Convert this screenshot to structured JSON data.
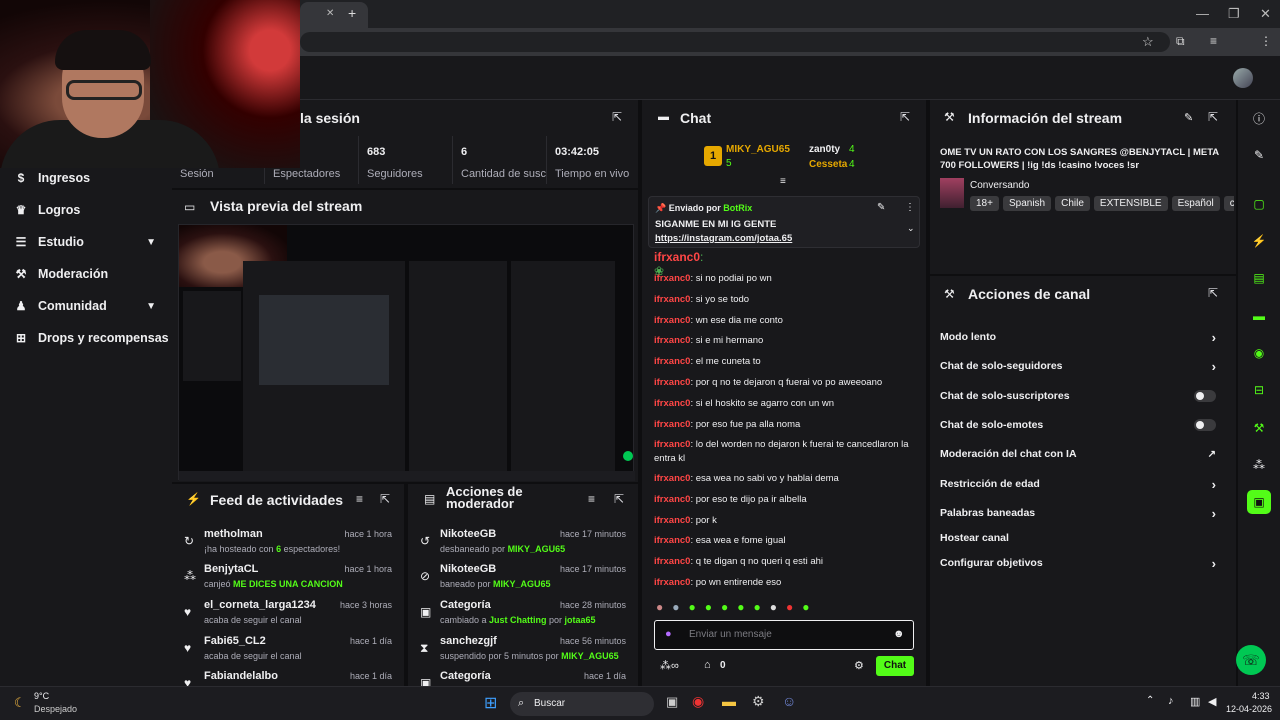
{
  "browser": {
    "new_tab": "+",
    "win_min": "—",
    "win_max": "❐",
    "win_close": "✕",
    "tab_close": "✕"
  },
  "nav": {
    "items": [
      {
        "label": "Ingresos"
      },
      {
        "label": "Logros"
      },
      {
        "label": "Estudio"
      },
      {
        "label": "Moderación"
      },
      {
        "label": "Comunidad"
      },
      {
        "label": "Drops y recompensas"
      }
    ]
  },
  "session": {
    "title": "la sesión",
    "stats": [
      {
        "value": "",
        "label": "Sesión"
      },
      {
        "value": "",
        "label": "Espectadores"
      },
      {
        "value": "683",
        "label": "Seguidores"
      },
      {
        "value": "6",
        "label": "Cantidad de suscripciones"
      },
      {
        "value": "03:42:05",
        "label": "Tiempo en vivo"
      }
    ]
  },
  "preview": {
    "title": "Vista previa del stream"
  },
  "feed": {
    "title": "Feed de actividades",
    "rows": [
      {
        "name": "metholman",
        "desc_a": "¡ha hosteado con ",
        "desc_b": "6",
        "desc_c": " espectadores!",
        "time": "hace 1 hora"
      },
      {
        "name": "BenjytaCL",
        "desc_a": "canjeó ",
        "desc_b": "ME DICES UNA CANCION",
        "desc_c": "",
        "time": "hace 1 hora"
      },
      {
        "name": "el_corneta_larga1234",
        "desc_a": "acaba de seguir el canal",
        "desc_b": "",
        "desc_c": "",
        "time": "hace 3 horas"
      },
      {
        "name": "Fabi65_CL2",
        "desc_a": "acaba de seguir el canal",
        "desc_b": "",
        "desc_c": "",
        "time": "hace 1 día"
      },
      {
        "name": "Fabiandelalbo",
        "desc_a": "",
        "desc_b": "",
        "desc_c": "",
        "time": "hace 1 día"
      }
    ]
  },
  "modactions": {
    "title_line1": "Acciones de",
    "title_line2": "moderador",
    "rows": [
      {
        "name": "NikoteeGB",
        "desc_a": "desbaneado por ",
        "desc_b": "MIKY_AGU65",
        "desc_c": "",
        "desc_d": "",
        "time": "hace 17 minutos"
      },
      {
        "name": "NikoteeGB",
        "desc_a": "baneado por ",
        "desc_b": "MIKY_AGU65",
        "desc_c": "",
        "desc_d": "",
        "time": "hace 17 minutos"
      },
      {
        "name": "Categoría",
        "desc_a": "cambiado a ",
        "desc_b": "Just Chatting",
        "desc_c": " por ",
        "desc_d": "jotaa65",
        "time": "hace 28 minutos"
      },
      {
        "name": "sanchezgjf",
        "desc_a": "suspendido por 5 minutos por ",
        "desc_b": "MIKY_AGU65",
        "desc_c": "",
        "desc_d": "",
        "time": "hace 56 minutos"
      },
      {
        "name": "Categoría",
        "desc_a": "",
        "desc_b": "",
        "desc_c": "",
        "desc_d": "",
        "time": "hace 1 día"
      }
    ]
  },
  "chat": {
    "title": "Chat",
    "leaders": {
      "rank": "1",
      "first": "MIKY_AGU65",
      "first_count": "5",
      "second": "zan0ty",
      "second_count": "4",
      "third": "Cesseta",
      "third_count": "4"
    },
    "pinned": {
      "sent_by": "Enviado por",
      "bot": "BotRix",
      "message": "SIGANME EN MI IG GENTE",
      "link": "https://instagram.com/jotaa.65"
    },
    "messages": [
      {
        "user": "ifrxanc0",
        "text": " si no podiai po wn"
      },
      {
        "user": "ifrxanc0",
        "text": " si yo se todo"
      },
      {
        "user": "ifrxanc0",
        "text": " wn ese dia me conto"
      },
      {
        "user": "ifrxanc0",
        "text": " si e mi hermano"
      },
      {
        "user": "ifrxanc0",
        "text": " el me cuneta to"
      },
      {
        "user": "ifrxanc0",
        "text": " por q no te dejaron q fuerai vo po aweeoano"
      },
      {
        "user": "ifrxanc0",
        "text": " si el hoskito se agarro con un wn"
      },
      {
        "user": "ifrxanc0",
        "text": " por eso fue pa alla noma"
      },
      {
        "user": "ifrxanc0",
        "text": " lo del worden no dejaron k fuerai te cancedlaron la entra kl"
      },
      {
        "user": "ifrxanc0",
        "text": " esa wea no sabi vo y hablai dema"
      },
      {
        "user": "ifrxanc0",
        "text": " por eso te dijo pa ir albella"
      },
      {
        "user": "ifrxanc0",
        "text": " por k"
      },
      {
        "user": "ifrxanc0",
        "text": " esa wea e fome igual"
      },
      {
        "user": "ifrxanc0",
        "text": " q te digan q no queri q esti ahi"
      },
      {
        "user": "ifrxanc0",
        "text": " po wn entirende eso"
      }
    ],
    "input_placeholder": "Enviar un mensaje",
    "points": "0",
    "send_label": "Chat"
  },
  "streaminfo": {
    "title": "Información del stream",
    "stream_title": "OME TV UN RATO CON LOS SANGRES @BENJYTACL | META 700 FOLLOWERS | !ig !ds !casino !voces !sr",
    "category": "Conversando",
    "tags": [
      "18+",
      "Spanish",
      "Chile",
      "EXTENSIBLE",
      "Español",
      "c"
    ]
  },
  "channelactions": {
    "title": "Acciones de canal",
    "rows": [
      {
        "label": "Modo lento",
        "kind": "chevron"
      },
      {
        "label": "Chat de solo-seguidores",
        "kind": "chevron"
      },
      {
        "label": "Chat de solo-suscriptores",
        "kind": "toggle"
      },
      {
        "label": "Chat de solo-emotes",
        "kind": "toggle"
      },
      {
        "label": "Moderación del chat con IA",
        "kind": "external"
      },
      {
        "label": "Restricción de edad",
        "kind": "chevron"
      },
      {
        "label": "Palabras baneadas",
        "kind": "chevron"
      },
      {
        "label": "Hostear canal",
        "kind": "none"
      },
      {
        "label": "Configurar objetivos",
        "kind": "chevron"
      }
    ]
  },
  "taskbar": {
    "temp": "9°C",
    "weather": "Despejado",
    "search": "Buscar",
    "time": "4:33",
    "date": "12-04-2026"
  },
  "colors": {
    "accent": "#53fc18",
    "panel": "#18181b",
    "chat_user": "#ff4646"
  }
}
